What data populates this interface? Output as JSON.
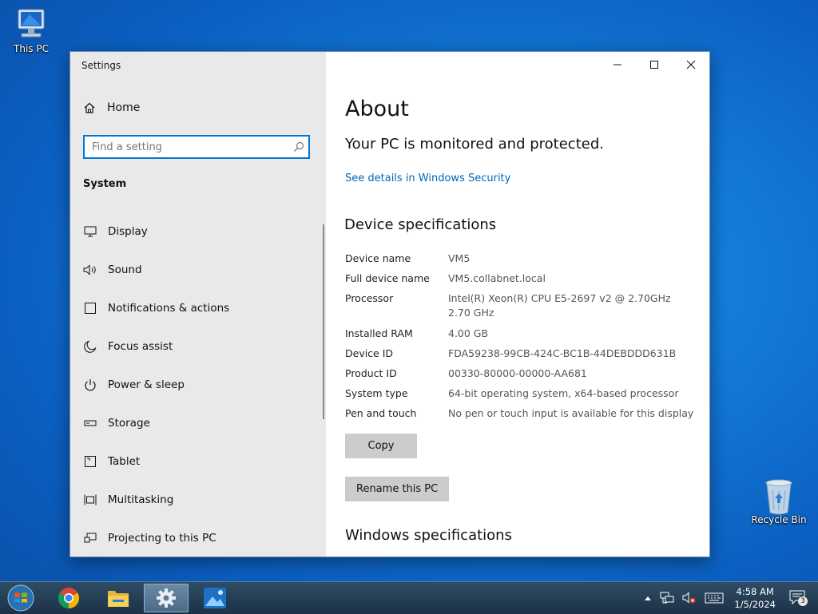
{
  "desktop": {
    "icons": [
      {
        "label": "This PC"
      },
      {
        "label": "Recycle Bin"
      }
    ]
  },
  "window": {
    "title": "Settings",
    "buttons": {
      "minimize": "minimize-icon",
      "maximize": "maximize-icon",
      "close": "close-icon"
    }
  },
  "sidebar": {
    "home_label": "Home",
    "search_placeholder": "Find a setting",
    "section": "System",
    "items": [
      {
        "label": "Display",
        "icon": "display-icon"
      },
      {
        "label": "Sound",
        "icon": "speaker-icon"
      },
      {
        "label": "Notifications & actions",
        "icon": "notification-icon"
      },
      {
        "label": "Focus assist",
        "icon": "moon-icon"
      },
      {
        "label": "Power & sleep",
        "icon": "power-icon"
      },
      {
        "label": "Storage",
        "icon": "storage-icon"
      },
      {
        "label": "Tablet",
        "icon": "tablet-icon"
      },
      {
        "label": "Multitasking",
        "icon": "multitasking-icon"
      },
      {
        "label": "Projecting to this PC",
        "icon": "projecting-icon"
      }
    ]
  },
  "main": {
    "title": "About",
    "protection_status": "Your PC is monitored and protected.",
    "security_link": "See details in Windows Security",
    "device_section": "Device specifications",
    "specs": [
      {
        "key": "Device name",
        "value": "VM5"
      },
      {
        "key": "Full device name",
        "value": "VM5.collabnet.local"
      },
      {
        "key": "Processor",
        "value": "Intel(R) Xeon(R) CPU E5-2697 v2 @ 2.70GHz",
        "value2": "2.70 GHz"
      },
      {
        "key": "Installed RAM",
        "value": "4.00 GB"
      },
      {
        "key": "Device ID",
        "value": "FDA59238-99CB-424C-BC1B-44DEBDDD631B"
      },
      {
        "key": "Product ID",
        "value": "00330-80000-00000-AA681"
      },
      {
        "key": "System type",
        "value": "64-bit operating system, x64-based processor"
      },
      {
        "key": "Pen and touch",
        "value": "No pen or touch input is available for this display"
      }
    ],
    "copy_label": "Copy",
    "rename_label": "Rename this PC",
    "windows_section": "Windows specifications"
  },
  "taskbar": {
    "apps": [
      "chrome-icon",
      "file-explorer-icon",
      "settings-gear-icon",
      "photos-icon"
    ],
    "active_app": "settings-gear-icon",
    "time": "4:58 AM",
    "date": "1/5/2024",
    "notification_count": "3",
    "colors": {
      "accent": "#0078d4",
      "link": "#0067b8"
    }
  }
}
